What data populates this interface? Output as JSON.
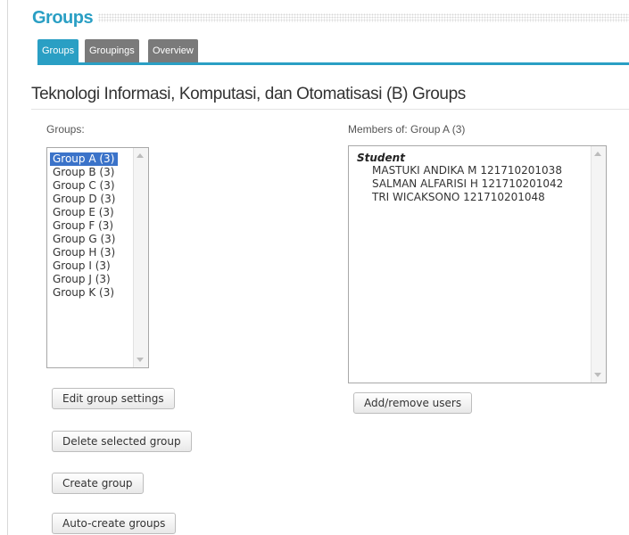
{
  "header": {
    "title": "Groups"
  },
  "tabs": [
    {
      "label": "Groups",
      "active": true
    },
    {
      "label": "Groupings",
      "active": false
    },
    {
      "label": "Overview",
      "active": false
    }
  ],
  "page_heading": "Teknologi Informasi, Komputasi, dan Otomatisasi (B) Groups",
  "groups_panel": {
    "label": "Groups:",
    "options": [
      "Group A (3)",
      "Group B (3)",
      "Group C (3)",
      "Group D (3)",
      "Group E (3)",
      "Group F (3)",
      "Group G (3)",
      "Group H (3)",
      "Group I (3)",
      "Group J (3)",
      "Group K (3)"
    ],
    "selected": "Group A (3)"
  },
  "members_panel": {
    "label": "Members of: Group A (3)",
    "role": "Student",
    "members": [
      "MASTUKI ANDIKA M 121710201038",
      "SALMAN ALFARISI H 121710201042",
      "TRI WICAKSONO 121710201048"
    ]
  },
  "buttons": {
    "edit_group": "Edit group settings",
    "delete_group": "Delete selected group",
    "create_group": "Create group",
    "auto_create": "Auto-create groups",
    "add_remove": "Add/remove users"
  },
  "colors": {
    "accent": "#2a9fc4",
    "tab_inactive": "#7a7a7a",
    "selection": "#3b73c9"
  }
}
